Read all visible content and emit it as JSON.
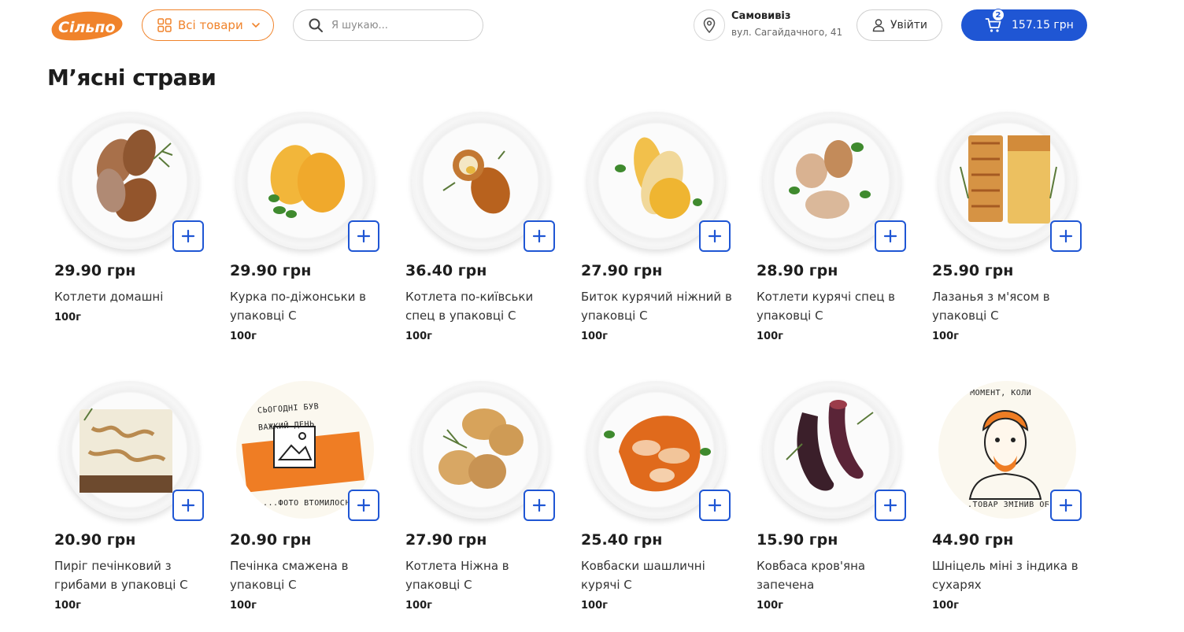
{
  "header": {
    "logo_text": "Сільпо",
    "all_goods_label": "Всі товари",
    "search_placeholder": "Я шукаю...",
    "delivery_title": "Самовивіз",
    "delivery_address": "вул. Сагайдачного, 41",
    "login_label": "Увійти",
    "cart_total": "157.15 грн",
    "cart_count": "2"
  },
  "page": {
    "title": "М’ясні страви"
  },
  "colors": {
    "accent_orange": "#f0832b",
    "accent_blue": "#1f56d4"
  },
  "products": [
    {
      "price": "29.90 грн",
      "name": "Котлети домашні",
      "weight": "100г",
      "art": "cutlets"
    },
    {
      "price": "29.90 грн",
      "name": "Курка по-діжонськи в упаковці С",
      "weight": "100г",
      "art": "dijon"
    },
    {
      "price": "36.40 грн",
      "name": "Котлета по-київськи спец в упаковці С",
      "weight": "100г",
      "art": "kiev"
    },
    {
      "price": "27.90 грн",
      "name": "Биток курячий ніжний в упаковці С",
      "weight": "100г",
      "art": "bitok"
    },
    {
      "price": "28.90 грн",
      "name": "Котлети курячі спец в упаковці С",
      "weight": "100г",
      "art": "chicken-cutlets"
    },
    {
      "price": "25.90 грн",
      "name": "Лазанья з м'ясом в упаковці С",
      "weight": "100г",
      "art": "lasagna"
    },
    {
      "price": "20.90 грн",
      "name": "Пиріг печінковий з грибами в упаковці С",
      "weight": "100г",
      "art": "pie"
    },
    {
      "price": "20.90 грн",
      "name": "Печінка смажена в упаковці С",
      "weight": "100г",
      "art": "placeholder-photo",
      "art_text": [
        "СЬОГОДНІ БУВ",
        "ВАЖКИЙ ДЕНЬ",
        "...ФОТО ВТОМИЛОСЬ"
      ]
    },
    {
      "price": "27.90 грн",
      "name": "Котлета Ніжна в упаковці С",
      "weight": "100г",
      "art": "tender-cutlets"
    },
    {
      "price": "25.40 грн",
      "name": "Ковбаски шашличні курячі С",
      "weight": "100г",
      "art": "sausages"
    },
    {
      "price": "15.90 грн",
      "name": "Ковбаса кров'яна запечена",
      "weight": "100г",
      "art": "blood-sausage"
    },
    {
      "price": "44.90 грн",
      "name": "Шніцель міні з індика в сухарях",
      "weight": "100г",
      "art": "placeholder-person",
      "art_text": [
        "ТОЙ МОМЕНТ, КОЛИ",
        "...ТОВАР ЗМІНИВ ОБГОРТКУ"
      ]
    }
  ]
}
